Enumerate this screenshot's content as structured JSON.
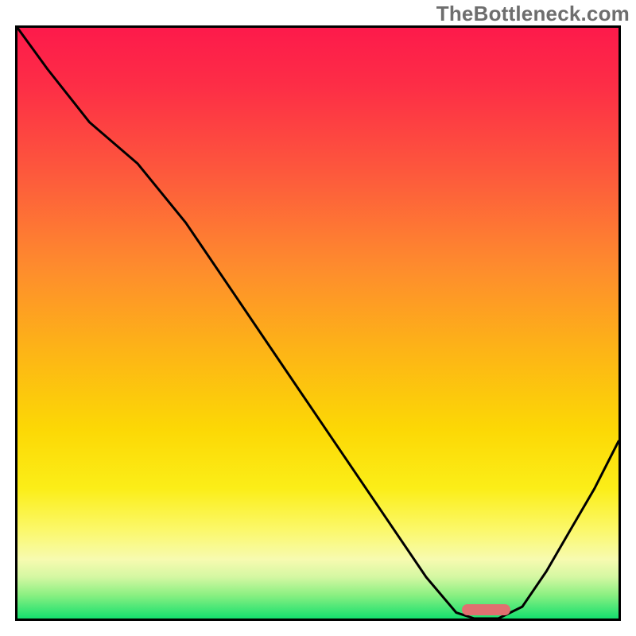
{
  "watermark": "TheBottleneck.com",
  "colors": {
    "frame": "#000000",
    "curve": "#000000",
    "marker": "#e07070",
    "gradient_top": "#fd1a4b",
    "gradient_bottom": "#15df6e"
  },
  "chart_data": {
    "type": "line",
    "title": "",
    "xlabel": "",
    "ylabel": "",
    "xlim": [
      0,
      100
    ],
    "ylim": [
      0,
      100
    ],
    "grid": false,
    "legend": false,
    "notes": "Background is a vertical heat gradient (red→green). The black curve depicts a bottleneck metric that descends from ~100 at x=0 to ~0 near x≈75–80, stays flat over a short interval, then rises again toward x=100. Small salmon bar marks the flat minimum segment.",
    "series": [
      {
        "name": "bottleneck_curve",
        "x": [
          0,
          5,
          12,
          20,
          28,
          36,
          44,
          52,
          60,
          68,
          73,
          76,
          80,
          84,
          88,
          92,
          96,
          100
        ],
        "values": [
          100,
          93,
          84,
          77,
          67,
          55,
          43,
          31,
          19,
          7,
          1,
          0,
          0,
          2,
          8,
          15,
          22,
          30
        ]
      }
    ],
    "flat_min_region": {
      "x_start": 74,
      "x_end": 82,
      "y": 1.5
    }
  }
}
